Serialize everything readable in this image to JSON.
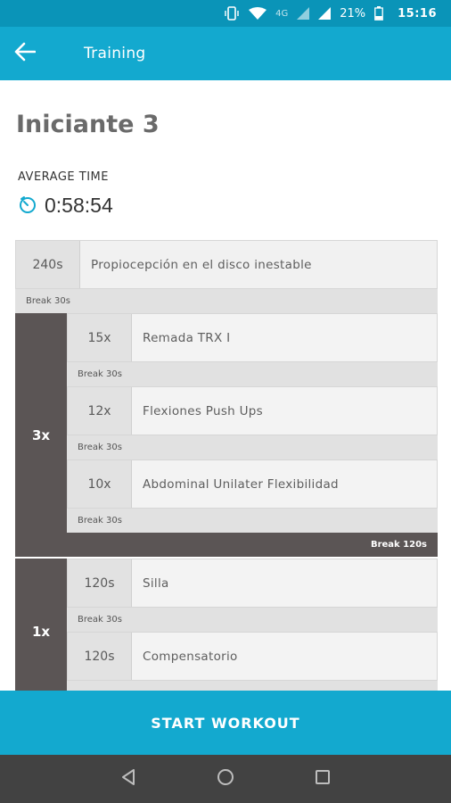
{
  "status_bar": {
    "network_label": "4G",
    "battery": "21%",
    "time": "15:16",
    "icons": [
      "vibrate-icon",
      "wifi-icon",
      "signal-icon",
      "signal-icon",
      "battery-icon"
    ]
  },
  "app_bar": {
    "title": "Training",
    "back_icon": "arrow-left-icon"
  },
  "program": {
    "title": "Iniciante 3",
    "average_time_label": "AVERAGE TIME",
    "average_time": "0:58:54",
    "timer_icon": "stopwatch-icon"
  },
  "plan": {
    "first": {
      "qty": "240s",
      "name": "Propiocepción en el disco inestable",
      "break": "Break 30s"
    },
    "blocks": [
      {
        "count": "3x",
        "exercises": [
          {
            "qty": "15x",
            "name": "Remada TRX I",
            "break": "Break 30s"
          },
          {
            "qty": "12x",
            "name": "Flexiones Push Ups",
            "break": "Break 30s"
          },
          {
            "qty": "10x",
            "name": "Abdominal Unilater Flexibilidad",
            "break": "Break 30s"
          }
        ],
        "block_break": "Break 120s"
      },
      {
        "count": "1x",
        "exercises": [
          {
            "qty": "120s",
            "name": "Silla",
            "break": "Break 30s"
          },
          {
            "qty": "120s",
            "name": "Compensatorio",
            "break": ""
          }
        ]
      }
    ]
  },
  "start_button": {
    "label": "START WORKOUT"
  },
  "colors": {
    "primary": "#13a9cf",
    "status": "#0a94b8",
    "block": "#5b5555",
    "navbar": "#424242"
  }
}
